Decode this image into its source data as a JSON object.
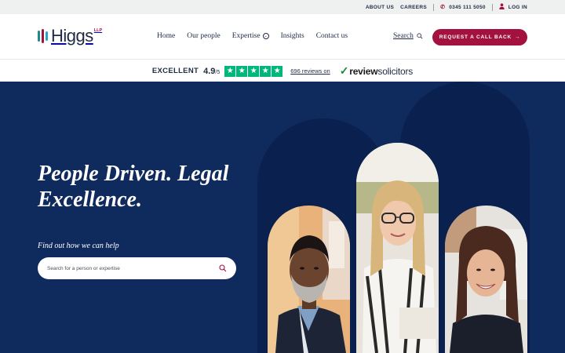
{
  "topbar": {
    "about": "ABOUT US",
    "careers": "CAREERS",
    "phone": "0345 111 5050",
    "login": "LOG IN"
  },
  "header": {
    "logo_text": "Higgs",
    "logo_suffix": "LLP",
    "nav": [
      "Home",
      "Our people",
      "Expertise",
      "Insights",
      "Contact us"
    ],
    "search_label": "Search",
    "cta_label": "REQUEST A CALL BACK",
    "cta_arrow": "→"
  },
  "reviews": {
    "rating_word": "EXCELLENT",
    "score": "4.9",
    "score_suffix": "/5",
    "stars": 5,
    "count_text": "696 reviews on",
    "brand_prefix": "review",
    "brand_suffix": "solicitors"
  },
  "hero": {
    "title": "People Driven. Legal Excellence.",
    "help_label": "Find out how we can help",
    "search_placeholder": "Search for a person or expertise"
  },
  "colors": {
    "navy": "#0f2a5c",
    "accent": "#a3123f",
    "text_dark": "#1f2a44",
    "trustpilot_green": "#00b67a"
  },
  "icons": {
    "phone": "phone-icon",
    "user": "user-icon",
    "search": "search-icon",
    "chevron": "chevron-down-icon",
    "arrow": "arrow-right-icon",
    "star": "star-icon",
    "check": "checkmark-icon"
  }
}
